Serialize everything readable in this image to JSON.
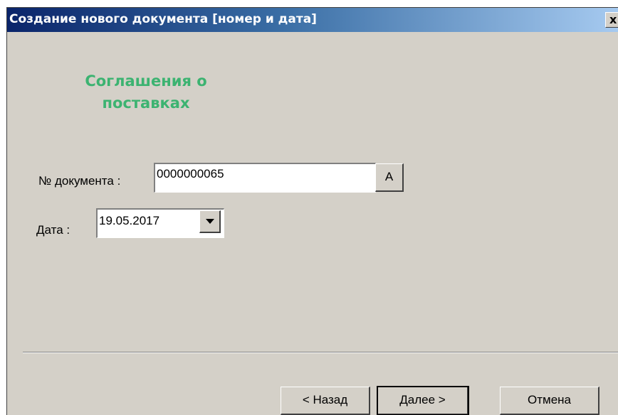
{
  "window": {
    "title": "Создание нового документа [номер и дата]",
    "close_label": "x"
  },
  "document_type": "Соглашения о поставках",
  "document_number": {
    "label": "№ документа :",
    "value": "0000000065",
    "auto_button_label": "A"
  },
  "date": {
    "label": "Дата :",
    "value": "19.05.2017"
  },
  "buttons": {
    "back": "< Назад",
    "next": "Далее >",
    "cancel": "Отмена"
  },
  "colors": {
    "accent_text": "#3cb371",
    "titlebar_start": "#0a246a",
    "titlebar_end": "#a6caf0",
    "dialog_background": "#d4d0c8"
  },
  "icons": {
    "close": "close-icon",
    "dropdown": "chevron-down-icon"
  }
}
